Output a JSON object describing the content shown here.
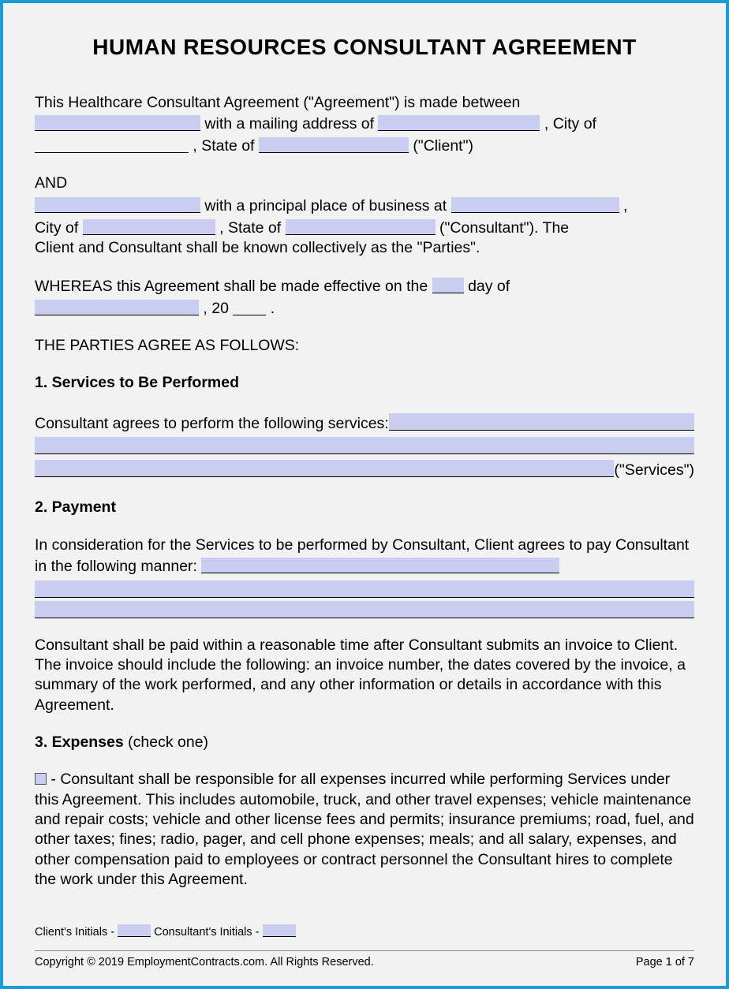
{
  "title": "HUMAN RESOURCES CONSULTANT AGREEMENT",
  "intro": {
    "line1_a": "This Healthcare Consultant Agreement (\"Agreement\") is made between",
    "line1_b": " with a mailing address of ",
    "line1_c": ", City of",
    "line2_a": ", State of ",
    "line2_b": " (\"Client\")"
  },
  "and": "AND",
  "consultant": {
    "line1_a": " with a principal place of business at ",
    "line1_b": ",",
    "line2_a": "City of ",
    "line2_b": ", State of ",
    "line2_c": " (\"Consultant\"). The",
    "line3": "Client and Consultant shall be known collectively as the \"Parties\"."
  },
  "whereas": {
    "a": "WHEREAS this Agreement shall be made effective on the ",
    "b": " day of",
    "c": ", 20",
    "d": "."
  },
  "agree": "THE PARTIES AGREE AS FOLLOWS:",
  "s1": {
    "head": "1. Services to Be Performed",
    "text": "Consultant agrees to perform the following services: ",
    "tail": " (\"Services\")"
  },
  "s2": {
    "head": "2. Payment",
    "text": "In consideration for the Services to be performed by Consultant, Client agrees to pay Consultant in the following manner: ",
    "para": "Consultant shall be paid within a reasonable time after Consultant submits an invoice to Client. The invoice should include the following: an invoice number, the dates covered by the invoice, a summary of the work performed, and any other information or details in accordance with this Agreement."
  },
  "s3": {
    "head_bold": "3. Expenses ",
    "head_norm": "(check one)",
    "opt": " - Consultant shall be responsible for all expenses incurred while performing Services under this Agreement. This includes automobile, truck, and other travel expenses; vehicle maintenance and repair costs; vehicle and other license fees and permits; insurance premiums; road, fuel, and other taxes; fines; radio, pager, and cell phone expenses; meals; and all salary, expenses, and other compensation paid to employees or contract personnel the Consultant hires to complete the work under this Agreement."
  },
  "initials": {
    "client": "Client's Initials - ",
    "consultant": " Consultant's Initials - "
  },
  "footer": {
    "copyright": "Copyright © 2019 EmploymentContracts.com. All Rights Reserved.",
    "page": "Page 1 of 7"
  }
}
